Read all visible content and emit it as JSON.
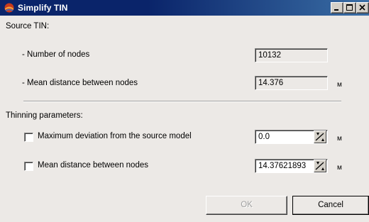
{
  "window": {
    "title": "Simplify TIN",
    "icon": "simplify-tin-app-icon",
    "controls": {
      "minimize": "minimize-icon",
      "maximize": "maximize-icon",
      "close": "close-icon"
    }
  },
  "source": {
    "header": "Source TIN:",
    "nodes_label": "- Number of nodes",
    "nodes_value": "10132",
    "mean_label": "- Mean distance between nodes",
    "mean_value": "14.376",
    "mean_unit": "м"
  },
  "thinning": {
    "header": "Thinning parameters:",
    "max_dev_label": "Maximum deviation from the source model",
    "max_dev_value": "0.0",
    "max_dev_unit": "м",
    "max_dev_checked": false,
    "mean_label": "Mean distance between nodes",
    "mean_value": "14.37621893",
    "mean_unit": "м",
    "mean_checked": false
  },
  "buttons": {
    "ok": "OK",
    "cancel": "Cancel"
  }
}
